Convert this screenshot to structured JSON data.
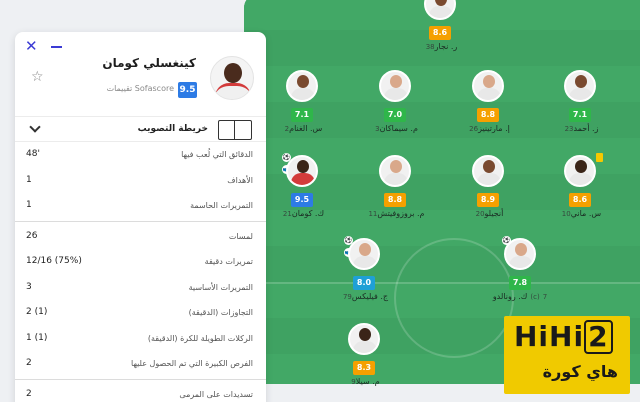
{
  "popup": {
    "player_name": "كينغسلي كومان",
    "source_label": "تقييمات Sofascore",
    "rating": "9.5",
    "heatmap_label": "خريطة التصويب",
    "stats": [
      {
        "value": "48'",
        "label": "الدقائق التي لُعب فيها"
      },
      {
        "value": "1",
        "label": "الأهداف"
      },
      {
        "value": "1",
        "label": "التمريرات الحاسمة"
      },
      {
        "value": "26",
        "label": "لمسات"
      },
      {
        "value": "12/16 (75%)",
        "label": "تمريرات دقيقة"
      },
      {
        "value": "3",
        "label": "التمريرات الأساسية"
      },
      {
        "value": "2 (1)",
        "label": "التجاوزات (الدقيقة)"
      },
      {
        "value": "1 (1)",
        "label": "الركلات الطويلة للكرة (الدقيقة)"
      },
      {
        "value": "2",
        "label": "الفرص الكبيرة التي تم الحصول عليها"
      },
      {
        "value": "2",
        "label": "تسديدات على المرمى"
      }
    ]
  },
  "players": [
    {
      "name": "ر. نجار",
      "num": "38",
      "rating": "8.6",
      "rating_color": "#f5a000"
    },
    {
      "name": "س. الغنام",
      "num": "2",
      "rating": "7.1",
      "rating_color": "#2fb64a"
    },
    {
      "name": "م. سيماكان",
      "num": "3",
      "rating": "7.0",
      "rating_color": "#2fb64a"
    },
    {
      "name": "إ. مارتينيز",
      "num": "26",
      "rating": "8.8",
      "rating_color": "#f5a000"
    },
    {
      "name": "ز. أحمد",
      "num": "23",
      "rating": "7.1",
      "rating_color": "#2fb64a"
    },
    {
      "name": "ك. كومان",
      "num": "21",
      "rating": "9.5",
      "rating_color": "#2d7be5"
    },
    {
      "name": "م. بروزوفيتش",
      "num": "11",
      "rating": "8.8",
      "rating_color": "#f5a000"
    },
    {
      "name": "أنجيلو",
      "num": "20",
      "rating": "8.9",
      "rating_color": "#f5a000"
    },
    {
      "name": "س. ماني",
      "num": "10",
      "rating": "8.6",
      "rating_color": "#f5a000"
    },
    {
      "name": "ج. فيليكس",
      "num": "79",
      "rating": "8.0",
      "rating_color": "#1fa0d6"
    },
    {
      "name": "ك. رونالدو",
      "num": "7",
      "captain": "(c)",
      "rating": "7.8",
      "rating_color": "#2fb64a"
    },
    {
      "name": "م. سيلا",
      "num": "9",
      "rating": "8.3",
      "rating_color": "#f5a000"
    }
  ],
  "watermark": {
    "brand": "HiHi",
    "digit": "2",
    "sub": "هاي كورة"
  },
  "icons": [
    "close-icon",
    "minimize-icon",
    "star-icon",
    "chevron-down-icon",
    "pitch-icon",
    "goal-ball-icon",
    "assist-boot-icon",
    "yellow-card-icon"
  ]
}
